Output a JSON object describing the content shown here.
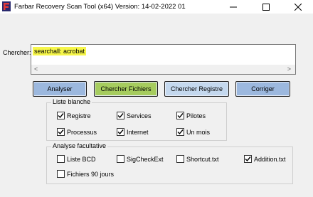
{
  "window": {
    "title": "Farbar Recovery Scan Tool (x64) Version: 14-02-2022 01",
    "minimize_symbol": "—",
    "maximize_symbol": "☐",
    "close_symbol": "✕"
  },
  "search": {
    "label": "Chercher:",
    "value": "searchall: acrobat",
    "scroll_left": "<",
    "scroll_right": ">"
  },
  "buttons": {
    "analyser": "Analyser",
    "chercher_fichiers": "Chercher Fichiers",
    "chercher_registre": "Chercher Registre",
    "corriger": "Corriger"
  },
  "colors": {
    "analyser_bg": "#9cb8de",
    "fichiers_bg": "#a6cc5e",
    "registre_bg": "#c4d8ee",
    "corriger_bg": "#9cb8de",
    "search_highlight": "#f6f64a"
  },
  "liste_blanche": {
    "legend": "Liste blanche",
    "items": [
      {
        "label": "Registre",
        "checked": true
      },
      {
        "label": "Services",
        "checked": true
      },
      {
        "label": "Pilotes",
        "checked": true
      },
      {
        "label": "Processus",
        "checked": true
      },
      {
        "label": "Internet",
        "checked": true
      },
      {
        "label": "Un mois",
        "checked": true
      }
    ]
  },
  "analyse_facultative": {
    "legend": "Analyse facultative",
    "items": [
      {
        "label": "Liste BCD",
        "checked": false
      },
      {
        "label": "SigCheckExt",
        "checked": false
      },
      {
        "label": "Shortcut.txt",
        "checked": false
      },
      {
        "label": "Addition.txt",
        "checked": true
      },
      {
        "label": "Fichiers 90 jours",
        "checked": false
      }
    ]
  }
}
